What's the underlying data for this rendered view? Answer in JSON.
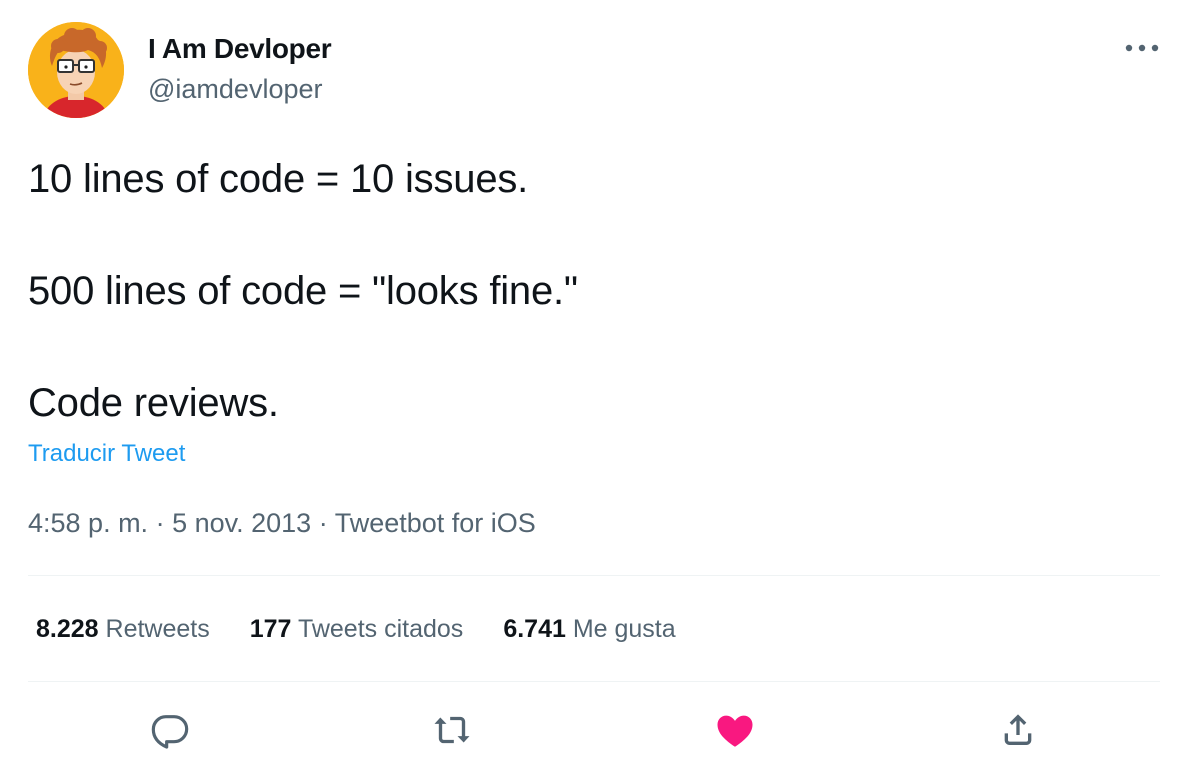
{
  "author": {
    "name": "I Am Devloper",
    "handle": "@iamdevloper"
  },
  "tweet": {
    "lines": [
      "10 lines of code = 10 issues.",
      "500 lines of code = \"looks fine.\"",
      "Code reviews."
    ],
    "translate_label": "Traducir Tweet",
    "time": "4:58 p. m.",
    "separator": " · ",
    "date": "5 nov. 2013",
    "source": "Tweetbot for iOS"
  },
  "stats": {
    "retweets": {
      "count": "8.228",
      "label": "Retweets"
    },
    "quotes": {
      "count": "177",
      "label": "Tweets citados"
    },
    "likes": {
      "count": "6.741",
      "label": "Me gusta"
    }
  },
  "icons": {
    "more": "more-dots-icon",
    "reply": "reply-icon",
    "retweet": "retweet-icon",
    "like": "heart-icon",
    "share": "share-icon"
  },
  "colors": {
    "link": "#1d9bf0",
    "muted": "#536471",
    "like_active": "#f91880",
    "avatar_bg": "#f9b21a"
  }
}
